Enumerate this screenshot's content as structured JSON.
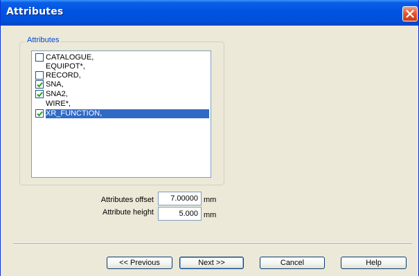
{
  "window": {
    "title": "Attributes"
  },
  "group": {
    "label": "Attributes"
  },
  "list": {
    "items": [
      {
        "label": "CATALOGUE,",
        "checkbox": true,
        "checked": false,
        "selected": false
      },
      {
        "label": "EQUIPOT*,",
        "checkbox": false,
        "checked": false,
        "selected": false
      },
      {
        "label": "RECORD,",
        "checkbox": true,
        "checked": false,
        "selected": false
      },
      {
        "label": "SNA,",
        "checkbox": true,
        "checked": true,
        "selected": false
      },
      {
        "label": "SNA2,",
        "checkbox": true,
        "checked": true,
        "selected": false
      },
      {
        "label": "WIRE*,",
        "checkbox": false,
        "checked": false,
        "selected": false
      },
      {
        "label": "XR_FUNCTION,",
        "checkbox": true,
        "checked": true,
        "selected": true
      }
    ]
  },
  "fields": {
    "offset": {
      "label": "Attributes offset",
      "value": "7.00000",
      "unit": "mm"
    },
    "height": {
      "label": "Attribute height",
      "value": "5.000",
      "unit": "mm"
    }
  },
  "buttons": {
    "previous": "<< Previous",
    "next": "Next >>",
    "cancel": "Cancel",
    "help": "Help"
  },
  "colors": {
    "title_bar": "#0053e1",
    "selection": "#316ac5",
    "check": "#21a121",
    "group_label": "#0046d5"
  },
  "icons": {
    "close": "close-icon",
    "check": "check-icon"
  }
}
